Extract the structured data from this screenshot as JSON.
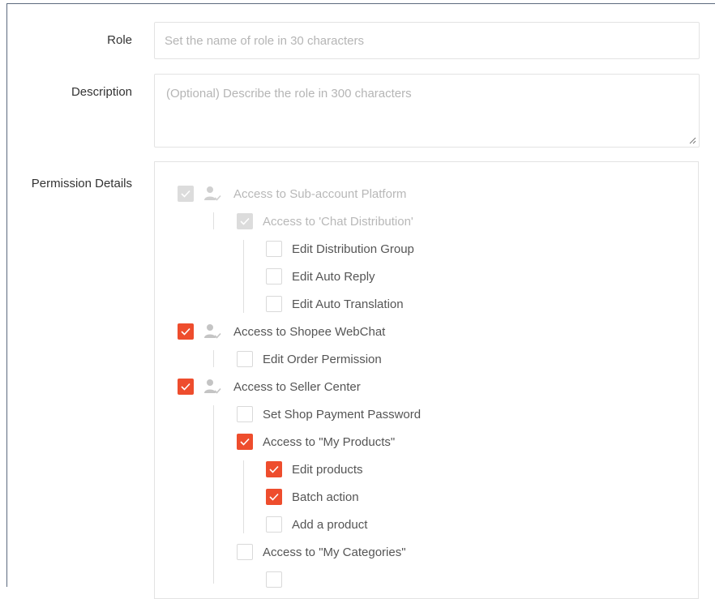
{
  "form": {
    "role_label": "Role",
    "role_placeholder": "Set the name of role in 30 characters",
    "description_label": "Description",
    "description_placeholder": "(Optional) Describe the role in 300 characters",
    "permission_label": "Permission Details"
  },
  "permissions": {
    "subaccount_platform": "Access to Sub-account Platform",
    "chat_distribution": "Access to 'Chat Distribution'",
    "edit_distribution_group": "Edit Distribution Group",
    "edit_auto_reply": "Edit Auto Reply",
    "edit_auto_translation": "Edit Auto Translation",
    "shopee_webchat": "Access to Shopee WebChat",
    "edit_order_permission": "Edit Order Permission",
    "seller_center": "Access to Seller Center",
    "set_shop_payment_password": "Set Shop Payment Password",
    "my_products": "Access to \"My Products\"",
    "edit_products": "Edit products",
    "batch_action": "Batch action",
    "add_product": "Add a product",
    "my_categories": "Access to \"My Categories\""
  },
  "colors": {
    "accent": "#ee4d2d",
    "disabled_check": "#dcdcdc",
    "border": "#e3e3e3"
  },
  "icons": {
    "role_user": "user-check-icon",
    "checkmark": "checkmark-icon"
  }
}
